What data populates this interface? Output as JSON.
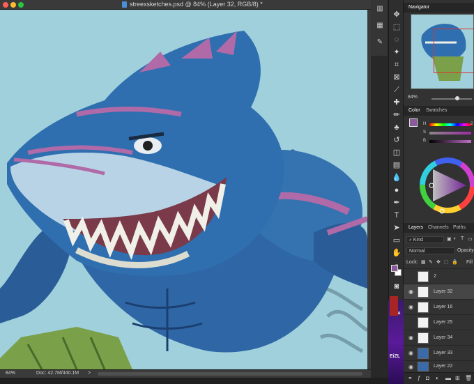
{
  "window": {
    "title": "streexsketches.psd @ 84% (Layer 32, RGB/8) *"
  },
  "status": {
    "zoom": "84%",
    "doc": "Doc: 42.7M/440.1M",
    "arrow": ">"
  },
  "navigator": {
    "tab": "Navigator",
    "zoom": "84%"
  },
  "color": {
    "tabs": [
      "Color",
      "Swatches"
    ],
    "h_label": "H",
    "s_label": "S",
    "b_label": "B",
    "h_value": "2",
    "foreground": "#8a5a9a",
    "background": "#ffffff"
  },
  "layers": {
    "tabs": [
      "Layers",
      "Channels",
      "Paths"
    ],
    "filter_kind": "Kind",
    "blend_mode": "Normal",
    "opacity_label": "Opacity",
    "lock_label": "Lock:",
    "fill_label": "Fill",
    "items": [
      {
        "name": "2",
        "visible": false
      },
      {
        "name": "Layer 32",
        "visible": true,
        "selected": true
      },
      {
        "name": "Layer 16",
        "visible": true
      },
      {
        "name": "Layer 25",
        "visible": false
      },
      {
        "name": "Layer 34",
        "visible": true
      },
      {
        "name": "Layer 33",
        "visible": true
      },
      {
        "name": "Layer 22",
        "visible": true
      }
    ]
  },
  "side_strip": {
    "text_top": "A-4u",
    "text_bottom": "EiZL"
  },
  "colors": {
    "canvas_bg": "#9fd0db",
    "shark_blue": "#2e6aa8",
    "shark_stripe": "#b06aa8",
    "accent": "#8a5a9a"
  }
}
